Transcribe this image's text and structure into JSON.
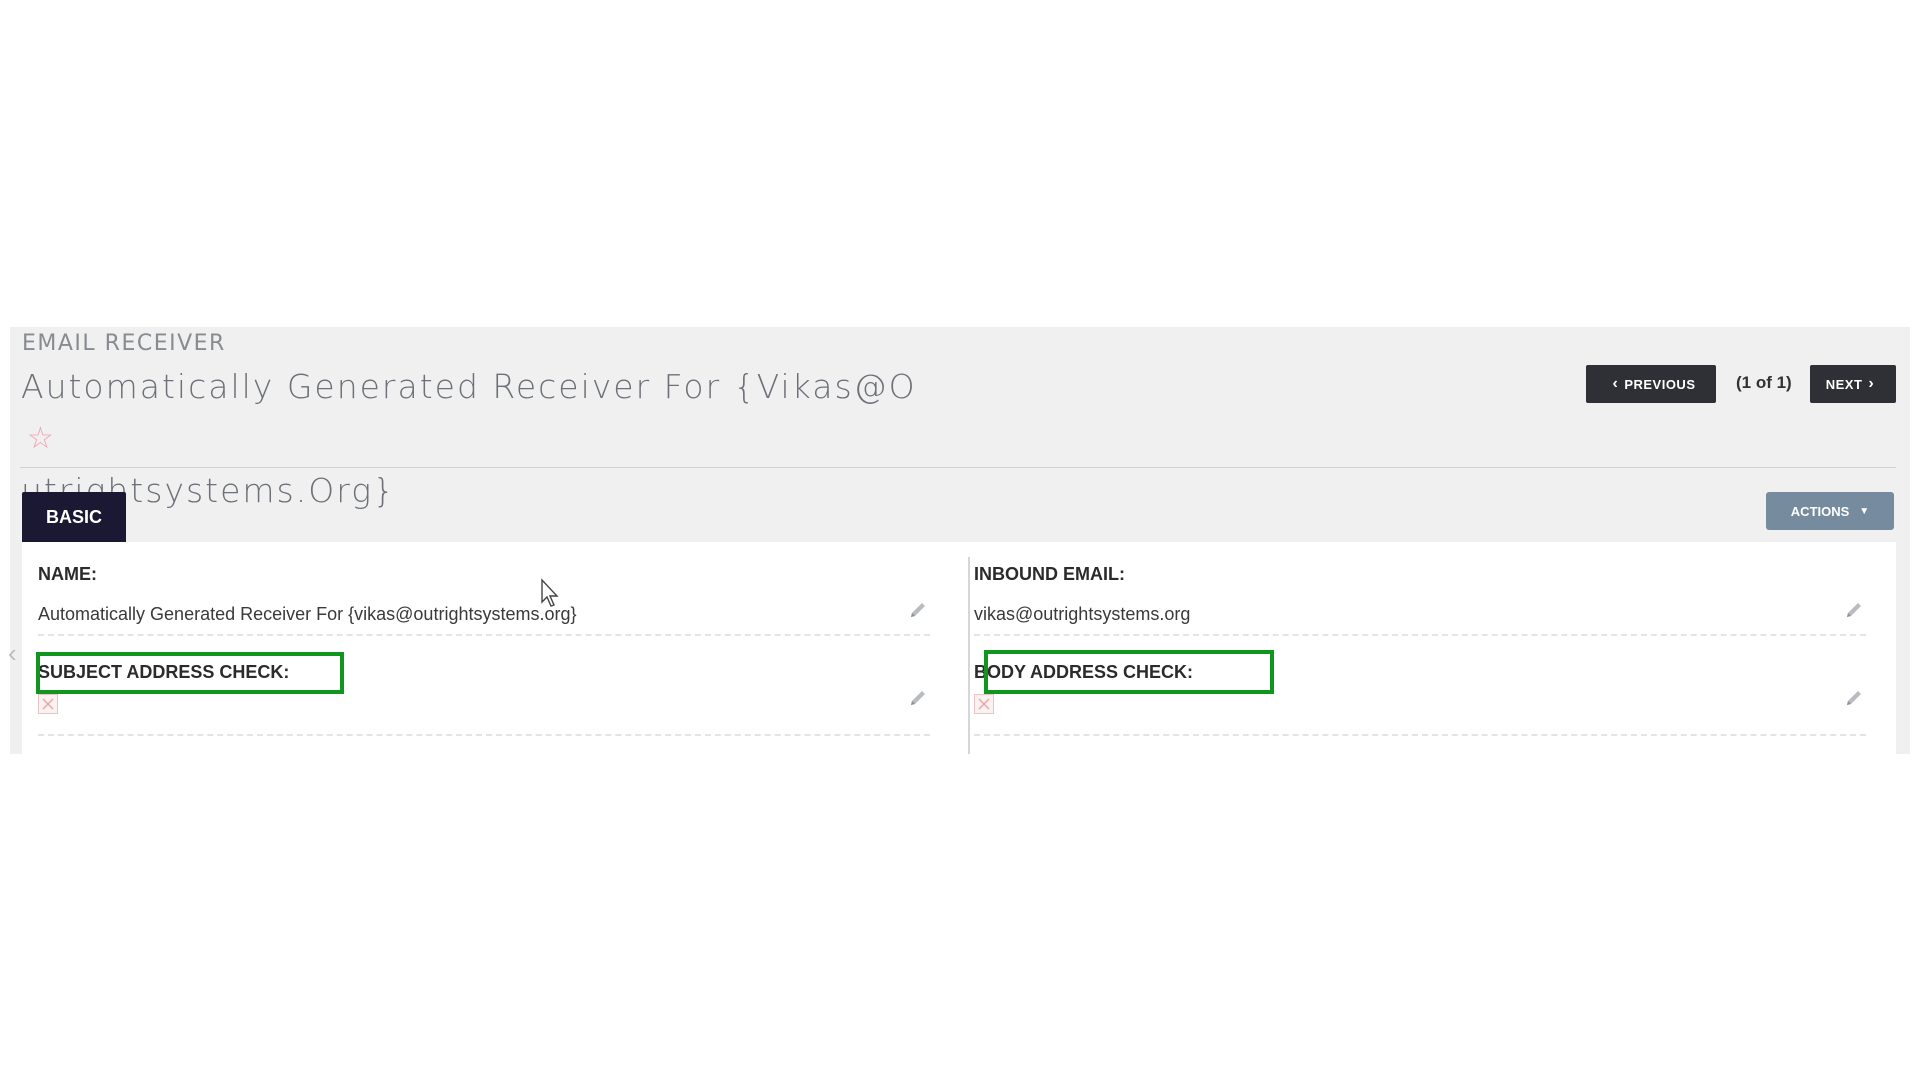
{
  "module": {
    "label": "EMAIL RECEIVER"
  },
  "record": {
    "title_line1": "Automatically Generated Receiver For {Vikas@O",
    "title_line2": "utrightsystems.Org}",
    "favorite_icon": "star-icon"
  },
  "pager": {
    "previous_label": "PREVIOUS",
    "count": "(1 of 1)",
    "next_label": "NEXT"
  },
  "tabs": [
    {
      "label": "BASIC",
      "active": true
    }
  ],
  "actions": {
    "label": "ACTIONS"
  },
  "fields": {
    "name": {
      "label": "NAME:",
      "value": "Automatically Generated Receiver For {vikas@outrightsystems.org}"
    },
    "inbound_email": {
      "label": "INBOUND EMAIL:",
      "value": "vikas@outrightsystems.org"
    },
    "subject_address_check": {
      "label": "SUBJECT ADDRESS CHECK:",
      "checked": false
    },
    "body_address_check": {
      "label": "BODY ADDRESS CHECK:",
      "checked": false
    }
  },
  "colors": {
    "highlight": "#10961e",
    "tab_active": "#1a1832",
    "actions_button": "#778b9f",
    "nav_button": "#2f3036"
  }
}
